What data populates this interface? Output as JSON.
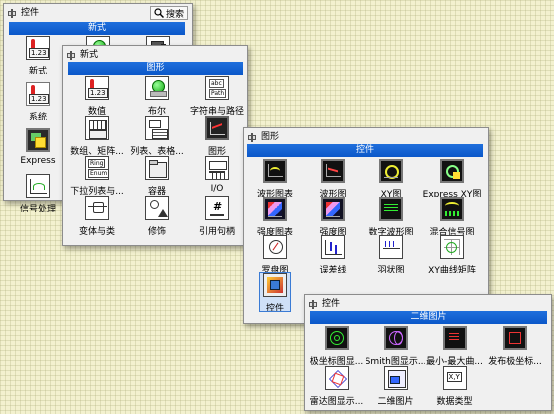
{
  "palette1": {
    "title": "控件",
    "search_label": "搜索",
    "header": "新式",
    "items": [
      {
        "label": "新式",
        "icon": "num-icon"
      },
      {
        "label": "系统",
        "icon": "system-icon"
      },
      {
        "label": "Express",
        "icon": "express-icon"
      },
      {
        "label": "信号处理",
        "icon": "signal-processing-icon"
      }
    ]
  },
  "palette2": {
    "title": "新式",
    "header": "图形",
    "items": [
      {
        "label": "数值",
        "icon": "numeric-icon"
      },
      {
        "label": "布尔",
        "icon": "boolean-icon"
      },
      {
        "label": "字符串与路径",
        "icon": "string-path-icon"
      },
      {
        "label": "数组、矩阵...",
        "icon": "array-matrix-icon"
      },
      {
        "label": "列表、表格...",
        "icon": "list-table-icon"
      },
      {
        "label": "图形",
        "icon": "graph-icon"
      },
      {
        "label": "下拉列表与...",
        "icon": "ring-enum-icon"
      },
      {
        "label": "容器",
        "icon": "container-icon"
      },
      {
        "label": "I/O",
        "icon": "io-icon"
      },
      {
        "label": "变体与类",
        "icon": "variant-class-icon"
      },
      {
        "label": "修饰",
        "icon": "decorations-icon"
      },
      {
        "label": "引用句柄",
        "icon": "refnum-icon"
      }
    ]
  },
  "palette3": {
    "title": "图形",
    "header": "控件",
    "items": [
      {
        "label": "波形图表",
        "icon": "waveform-chart-icon"
      },
      {
        "label": "波形图",
        "icon": "waveform-graph-icon"
      },
      {
        "label": "XY图",
        "icon": "xy-graph-icon"
      },
      {
        "label": "Express XY图",
        "icon": "express-xy-graph-icon"
      },
      {
        "label": "强度图表",
        "icon": "intensity-chart-icon"
      },
      {
        "label": "强度图",
        "icon": "intensity-graph-icon"
      },
      {
        "label": "数字波形图",
        "icon": "digital-waveform-icon"
      },
      {
        "label": "混合信号图",
        "icon": "mixed-signal-icon"
      },
      {
        "label": "罗盘图",
        "icon": "compass-plot-icon"
      },
      {
        "label": "误差线",
        "icon": "error-bar-icon"
      },
      {
        "label": "羽状图",
        "icon": "feather-plot-icon"
      },
      {
        "label": "XY曲线矩阵",
        "icon": "xy-plot-matrix-icon"
      },
      {
        "label": "控件",
        "icon": "controls-icon"
      }
    ]
  },
  "palette4": {
    "title": "控件",
    "header": "二维图片",
    "items": [
      {
        "label": "极坐标图显...",
        "icon": "polar-plot-icon"
      },
      {
        "label": "Smith图显示...",
        "icon": "smith-plot-icon"
      },
      {
        "label": "最小-最大曲...",
        "icon": "min-max-plot-icon"
      },
      {
        "label": "发布极坐标...",
        "icon": "publish-polar-icon"
      },
      {
        "label": "雷达图显示...",
        "icon": "radar-plot-icon"
      },
      {
        "label": "二维图片",
        "icon": "2d-picture-icon"
      },
      {
        "label": "数据类型",
        "icon": "data-type-icon"
      }
    ]
  }
}
